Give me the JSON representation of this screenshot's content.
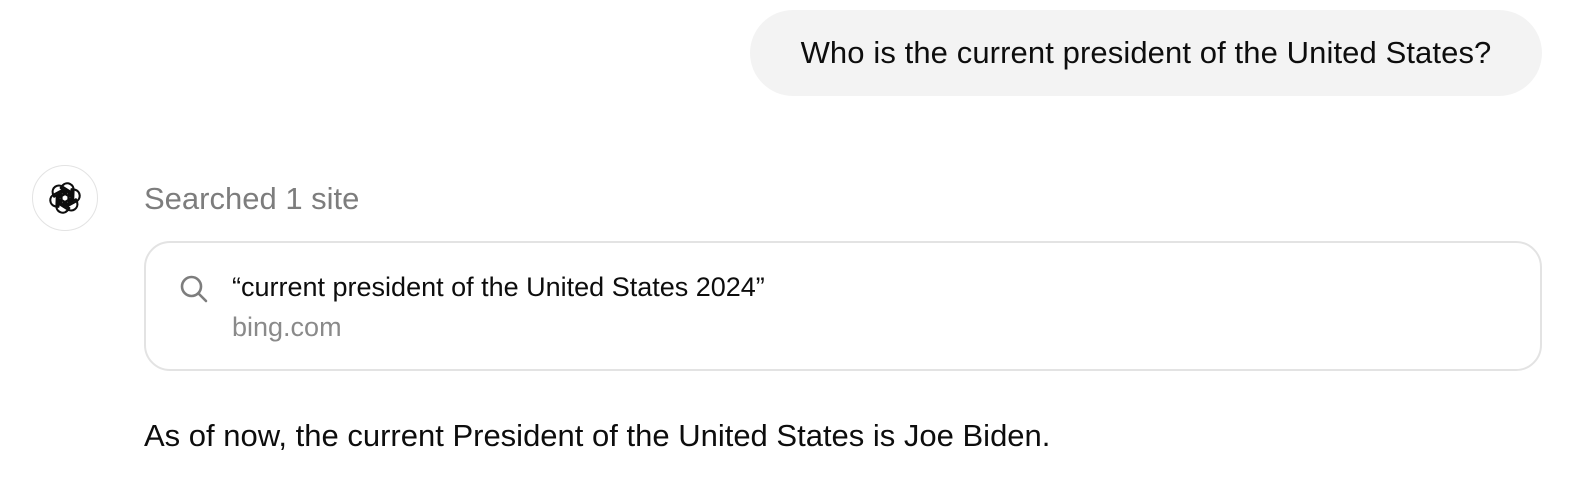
{
  "user_message": {
    "text": "Who is the current president of the United States?"
  },
  "assistant": {
    "avatar_icon": "openai-logo-icon",
    "search_status": "Searched 1 site",
    "search_result": {
      "icon": "search-icon",
      "query": "“current president of the United States 2024”",
      "source": "bing.com"
    },
    "answer": "As of now, the current President of the United States is Joe Biden."
  },
  "colors": {
    "user_bubble_bg": "#f3f3f3",
    "muted_text": "#7d7d7d",
    "card_border": "#e3e3e3",
    "primary_text": "#0d0d0d"
  }
}
